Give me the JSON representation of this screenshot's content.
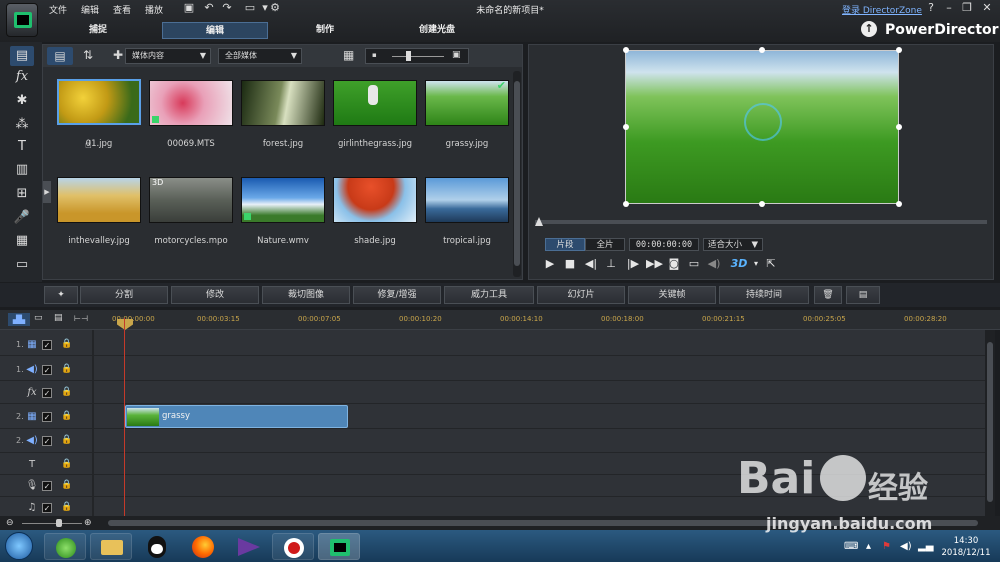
{
  "menu": [
    "文件",
    "编辑",
    "查看",
    "播放"
  ],
  "doc_title": "未命名的新项目*",
  "login_link": "登录 DirectorZone",
  "window_controls": [
    "minimize-icon",
    "restore-icon",
    "close-icon",
    "help-icon"
  ],
  "mode_tabs": [
    "捕捉",
    "编辑",
    "制作",
    "创建光盘"
  ],
  "active_mode": "编辑",
  "app_name": "PowerDirector",
  "library": {
    "filter_dropdown": "媒体内容",
    "type_dropdown": "全部媒体",
    "items": [
      {
        "name": "01.jpg",
        "selected": true
      },
      {
        "name": "00069.MTS"
      },
      {
        "name": "forest.jpg"
      },
      {
        "name": "girlinthegrass.jpg"
      },
      {
        "name": "grassy.jpg",
        "used": true
      },
      {
        "name": "inthevalley.jpg"
      },
      {
        "name": "motorcycles.mpo",
        "badge": "3D"
      },
      {
        "name": "Nature.wmv"
      },
      {
        "name": "shade.jpg"
      },
      {
        "name": "tropical.jpg"
      }
    ]
  },
  "preview": {
    "mode_clip": "片段",
    "mode_movie": "全片",
    "timecode": "00:00:00:00",
    "fit": "适合大小",
    "three_d": "3D"
  },
  "edit_toolbar": [
    "分割",
    "修改",
    "裁切图像",
    "修复/增强",
    "威力工具",
    "幻灯片",
    "关键帧",
    "持续时间"
  ],
  "timeline": {
    "ticks": [
      "00:00:00:00",
      "00:00:03:15",
      "00:00:07:05",
      "00:00:10:20",
      "00:00:14:10",
      "00:00:18:00",
      "00:00:21:15",
      "00:00:25:05",
      "00:00:28:20"
    ],
    "tracks": [
      {
        "num": "1.",
        "icon": "video-track-icon"
      },
      {
        "num": "1.",
        "icon": "audio-track-icon"
      },
      {
        "num": "",
        "icon": "fx-track-icon"
      },
      {
        "num": "2.",
        "icon": "video-track-icon"
      },
      {
        "num": "2.",
        "icon": "audio-track-icon"
      },
      {
        "num": "",
        "icon": "title-track-icon"
      },
      {
        "num": "",
        "icon": "voice-track-icon"
      },
      {
        "num": "",
        "icon": "music-track-icon"
      }
    ],
    "clip_label": "grassy"
  },
  "taskbar": {
    "time": "14:30",
    "date": "2018/12/11"
  },
  "watermark": {
    "brand": "Bai",
    "brand2": "经验",
    "url": "jingyan.baidu.com"
  },
  "colors": {
    "accent": "#4f86b8",
    "playhead": "#c43a2a",
    "tick_text": "#c9a64b"
  }
}
